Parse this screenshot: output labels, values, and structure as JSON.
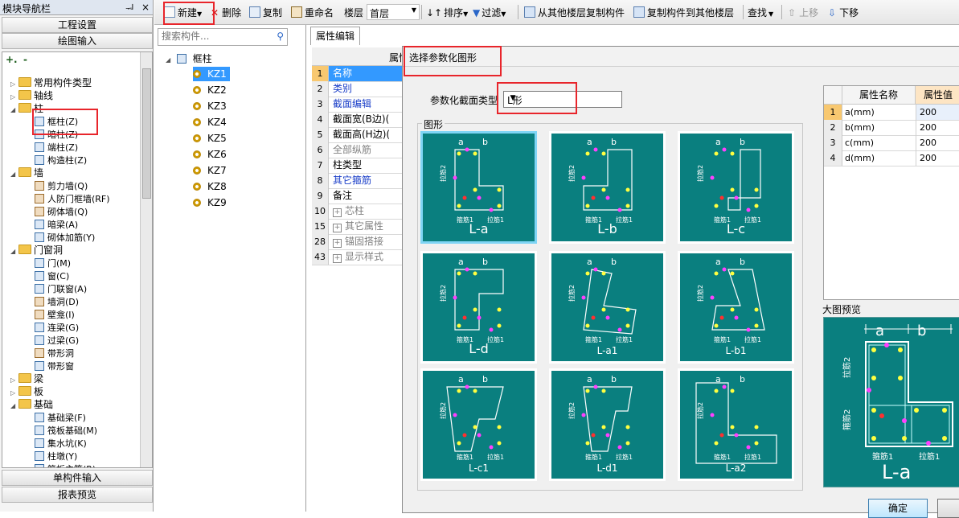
{
  "nav": {
    "title": "模块导航栏",
    "pin": "ᅯ",
    "close": "×",
    "section1": "工程设置",
    "section2": "绘图输入",
    "toolbar_plus": "+.",
    "toolbar_minus": "-",
    "tree": [
      {
        "label": "常用构件类型",
        "level": 0,
        "kind": "folder",
        "exp": "▷"
      },
      {
        "label": "轴线",
        "level": 0,
        "kind": "folder",
        "exp": "▷"
      },
      {
        "label": "柱",
        "level": 0,
        "kind": "folder",
        "exp": "◢"
      },
      {
        "label": "框柱(Z)",
        "level": 1,
        "kind": "item"
      },
      {
        "label": "暗柱(Z)",
        "level": 1,
        "kind": "item"
      },
      {
        "label": "端柱(Z)",
        "level": 1,
        "kind": "item"
      },
      {
        "label": "构造柱(Z)",
        "level": 1,
        "kind": "item"
      },
      {
        "label": "墙",
        "level": 0,
        "kind": "folder",
        "exp": "◢"
      },
      {
        "label": "剪力墙(Q)",
        "level": 1,
        "kind": "item-warm"
      },
      {
        "label": "人防门框墙(RF)",
        "level": 1,
        "kind": "item-warm"
      },
      {
        "label": "砌体墙(Q)",
        "level": 1,
        "kind": "item-warm"
      },
      {
        "label": "暗梁(A)",
        "level": 1,
        "kind": "item"
      },
      {
        "label": "砌体加筋(Y)",
        "level": 1,
        "kind": "item"
      },
      {
        "label": "门窗洞",
        "level": 0,
        "kind": "folder",
        "exp": "◢"
      },
      {
        "label": "门(M)",
        "level": 1,
        "kind": "item"
      },
      {
        "label": "窗(C)",
        "level": 1,
        "kind": "item"
      },
      {
        "label": "门联窗(A)",
        "level": 1,
        "kind": "item"
      },
      {
        "label": "墙洞(D)",
        "level": 1,
        "kind": "item-warm"
      },
      {
        "label": "壁龛(I)",
        "level": 1,
        "kind": "item-warm"
      },
      {
        "label": "连梁(G)",
        "level": 1,
        "kind": "item"
      },
      {
        "label": "过梁(G)",
        "level": 1,
        "kind": "item"
      },
      {
        "label": "带形洞",
        "level": 1,
        "kind": "item-warm"
      },
      {
        "label": "带形窗",
        "level": 1,
        "kind": "item"
      },
      {
        "label": "梁",
        "level": 0,
        "kind": "folder",
        "exp": "▷"
      },
      {
        "label": "板",
        "level": 0,
        "kind": "folder",
        "exp": "▷"
      },
      {
        "label": "基础",
        "level": 0,
        "kind": "folder",
        "exp": "◢"
      },
      {
        "label": "基础梁(F)",
        "level": 1,
        "kind": "item"
      },
      {
        "label": "筏板基础(M)",
        "level": 1,
        "kind": "item"
      },
      {
        "label": "集水坑(K)",
        "level": 1,
        "kind": "item"
      },
      {
        "label": "柱墩(Y)",
        "level": 1,
        "kind": "item"
      },
      {
        "label": "筏板主筋(R)",
        "level": 1,
        "kind": "item"
      }
    ],
    "bottom1": "单构件输入",
    "bottom2": "报表预览"
  },
  "toolbar": {
    "new": "新建",
    "delete": "删除",
    "copy": "复制",
    "rename": "重命名",
    "floor_label": "楼层",
    "floor_value": "首层",
    "sort": "排序",
    "filter": "过滤",
    "copy_from": "从其他楼层复制构件",
    "copy_to": "复制构件到其他楼层",
    "find": "查找",
    "move_up": "上移",
    "move_down": "下移"
  },
  "components": {
    "search_placeholder": "搜索构件...",
    "root": "框柱",
    "items": [
      "KZ1",
      "KZ2",
      "KZ3",
      "KZ4",
      "KZ5",
      "KZ6",
      "KZ7",
      "KZ8",
      "KZ9"
    ]
  },
  "props": {
    "tab": "属性编辑",
    "header": "属性",
    "rows": [
      {
        "n": "1",
        "t": "名称",
        "style": "selected"
      },
      {
        "n": "2",
        "t": "类别",
        "style": "blue"
      },
      {
        "n": "3",
        "t": "截面编辑",
        "style": "blue"
      },
      {
        "n": "4",
        "t": "截面宽(B边)(",
        "style": "normal"
      },
      {
        "n": "5",
        "t": "截面高(H边)(",
        "style": "normal"
      },
      {
        "n": "6",
        "t": "全部纵筋",
        "style": "gray"
      },
      {
        "n": "7",
        "t": "柱类型",
        "style": "normal"
      },
      {
        "n": "8",
        "t": "其它箍筋",
        "style": "blue"
      },
      {
        "n": "9",
        "t": "备注",
        "style": "normal"
      },
      {
        "n": "10",
        "t": "芯柱",
        "style": "gray-plus"
      },
      {
        "n": "15",
        "t": "其它属性",
        "style": "gray-plus"
      },
      {
        "n": "28",
        "t": "锚固搭接",
        "style": "gray-plus"
      },
      {
        "n": "43",
        "t": "显示样式",
        "style": "gray-plus"
      }
    ]
  },
  "dialog": {
    "title": "选择参数化图形",
    "type_label": "参数化截面类型",
    "type_value": "L形",
    "group_label": "图形",
    "shapes": [
      "L-a",
      "L-b",
      "L-c",
      "L-d",
      "L-a1",
      "L-b1",
      "L-c1",
      "L-d1",
      "L-a2"
    ],
    "selected_shape": "L-a",
    "attr_header_name": "属性名称",
    "attr_header_value": "属性值",
    "attrs": [
      {
        "n": "1",
        "k": "a(mm)",
        "v": "200"
      },
      {
        "n": "2",
        "k": "b(mm)",
        "v": "200"
      },
      {
        "n": "3",
        "k": "c(mm)",
        "v": "200"
      },
      {
        "n": "4",
        "k": "d(mm)",
        "v": "200"
      }
    ],
    "preview_label": "大图预览",
    "preview_caption": "L-a",
    "preview_dims": {
      "a": "a",
      "b": "b"
    },
    "preview_labels": {
      "tie1": "拉筋1",
      "tie2": "拉筋2",
      "stirrup1": "箍筋1",
      "stirrup2": "箍筋2"
    },
    "ok": "确定"
  },
  "shape_labels": {
    "tie1": "拉筋1",
    "tie2": "拉筋2",
    "stirrup1": "箍筋1",
    "stirrup2": "箍筋2",
    "a": "a",
    "b": "b",
    "c": "c",
    "d": "d"
  },
  "colors": {
    "teal": "#0a7f7f",
    "highlight": "#3399ff",
    "red_box": "#e8252b"
  }
}
